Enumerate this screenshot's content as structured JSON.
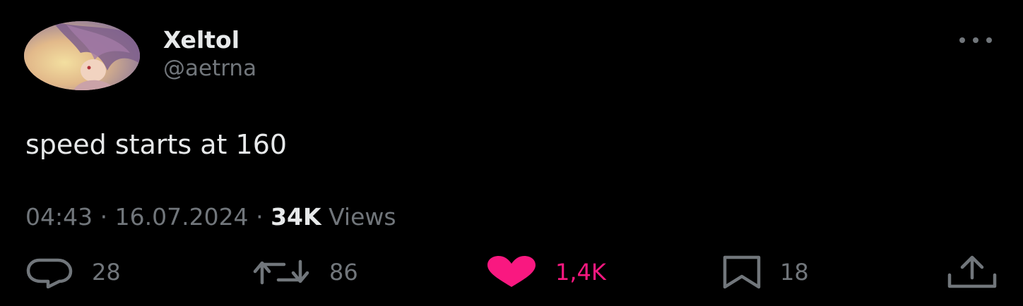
{
  "tweet": {
    "author": {
      "display_name": "Xeltol",
      "handle": "@aetrna",
      "avatar_icon": "anime-avatar"
    },
    "text": "speed starts at 160",
    "meta": {
      "time": "04:43",
      "separator": "·",
      "date": "16.07.2024",
      "views_count": "34K",
      "views_label": "Views"
    },
    "actions": {
      "replies": "28",
      "retweets": "86",
      "likes": "1,4K",
      "bookmarks": "18",
      "liked": true
    }
  },
  "colors": {
    "background": "#000000",
    "primary_text": "#e7e9ea",
    "secondary_text": "#71767b",
    "like_active": "#f91880"
  }
}
